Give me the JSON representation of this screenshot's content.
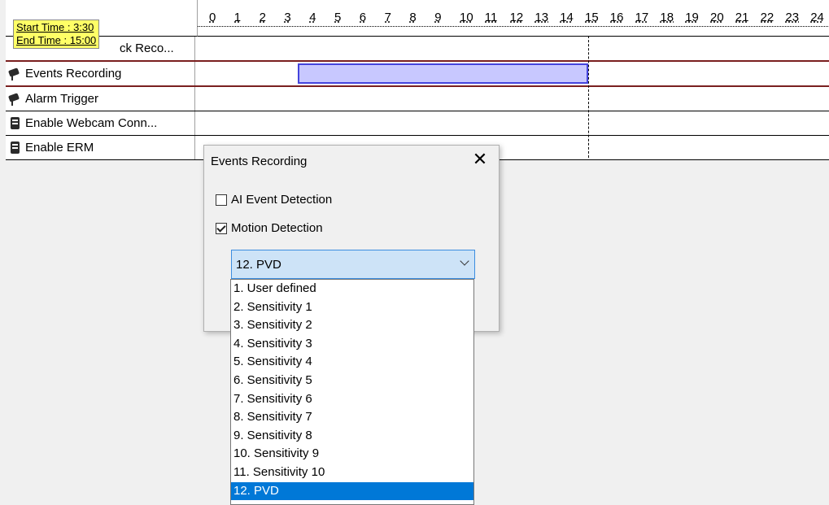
{
  "tooltip": {
    "start": "Start Time : 3:30",
    "end": "End Time : 15:00"
  },
  "ruler": {
    "hours": [
      "0",
      "1",
      "2",
      "3",
      "4",
      "5",
      "6",
      "7",
      "8",
      "9",
      "10",
      "11",
      "12",
      "13",
      "14",
      "15",
      "16",
      "17",
      "18",
      "19",
      "20",
      "21",
      "22",
      "23",
      "24"
    ]
  },
  "rows": [
    {
      "label": "ck Reco...",
      "icon": "hidden-icon"
    },
    {
      "label": "Events Recording",
      "icon": "camera-icon"
    },
    {
      "label": "Alarm Trigger",
      "icon": "camera-icon"
    },
    {
      "label": "Enable Webcam Conn...",
      "icon": "server-icon"
    },
    {
      "label": "Enable ERM",
      "icon": "server-icon"
    }
  ],
  "events_recording_block": {
    "start_hour": 3.5,
    "end_hour": 15.0
  },
  "dialog": {
    "title": "Events Recording",
    "close": "✕",
    "ai_event_detection": {
      "label": "AI Event Detection",
      "checked": false
    },
    "motion_detection": {
      "label": "Motion Detection",
      "checked": true
    },
    "select": {
      "value": "12. PVD"
    }
  },
  "dropdown": {
    "options": [
      "1. User defined",
      "2. Sensitivity 1",
      "3. Sensitivity 2",
      "4. Sensitivity 3",
      "5. Sensitivity 4",
      "6. Sensitivity 5",
      "7. Sensitivity 6",
      "8. Sensitivity 7",
      "9. Sensitivity 8",
      "10. Sensitivity 9",
      "11. Sensitivity 10",
      "12. PVD"
    ],
    "selected_index": 11
  },
  "colors": {
    "bar_fill": "#c8c8ff",
    "bar_border": "#4444dd",
    "highlight_row": "#7a1f1f",
    "tooltip_bg": "#ffff66",
    "selection": "#0078d7"
  }
}
